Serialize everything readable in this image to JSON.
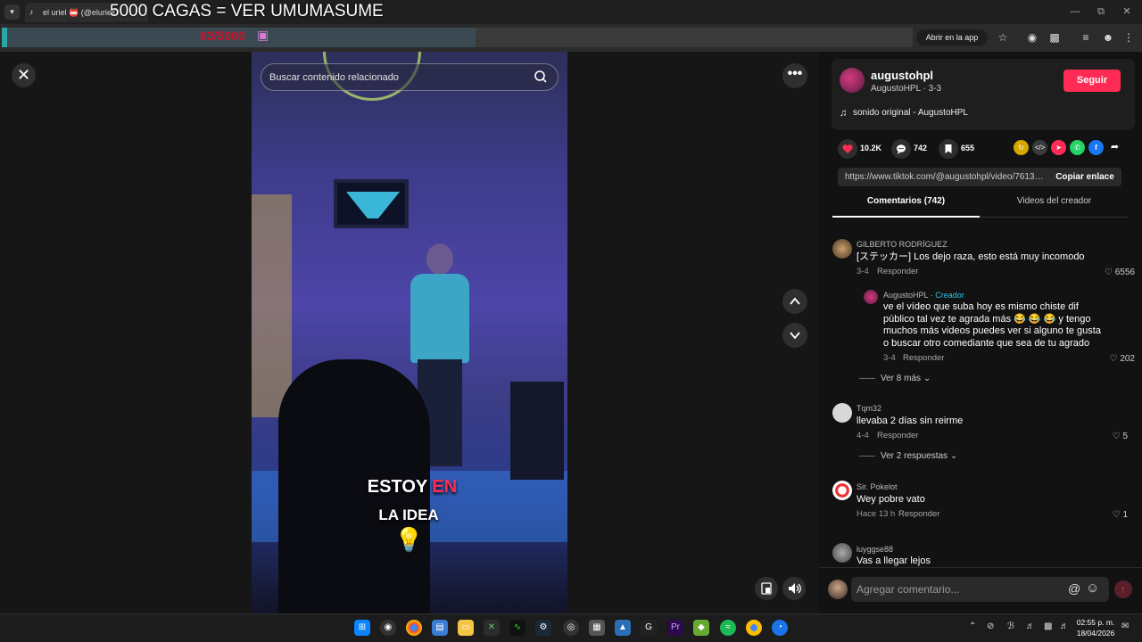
{
  "browser": {
    "tab_title": "el uriel 📛 (@eluriel0",
    "overlay_title": "5000 CAGAS = VER UMUMASUME",
    "progress_text": "63/5000",
    "open_app_label": "Abrir en la app",
    "window_min": "—",
    "window_restore": "⧉",
    "window_close": "✕"
  },
  "video": {
    "search_placeholder": "Buscar contenido relacionado",
    "caption_line1_a": "ESTOY ",
    "caption_line1_b": "EN",
    "caption_line2": "LA IDEA",
    "bulb": "💡",
    "close_glyph": "✕",
    "more_glyph": "•••"
  },
  "author": {
    "username": "augustohpl",
    "display": "AugustoHPL · 3-3",
    "follow_label": "Seguir",
    "music_glyph": "♫",
    "music": "sonido original - AugustoHPL"
  },
  "stats": {
    "likes": "10.2K",
    "comments": "742",
    "saves": "655"
  },
  "link": {
    "url": "https://www.tiktok.com/@augustohpl/video/76131...",
    "copy_label": "Copiar enlace"
  },
  "tabs": {
    "comments": "Comentarios (742)",
    "videos": "Videos del creador"
  },
  "comments": [
    {
      "name": "GILBERTO RODRÍGUEZ",
      "text": "[ステッカー] Los dejo raza, esto está muy incomodo",
      "date": "3-4",
      "reply": "Responder",
      "likes": "6556"
    },
    {
      "name": "AugustoHPL",
      "badge": "Creador",
      "text": "ve el vídeo que suba hoy es mismo chiste dif público tal vez te agrada más 😂 😂 😂 y tengo muchos más videos puedes ver si alguno te gusta o buscar otro comediante que sea de tu agrado",
      "date": "3-4",
      "reply": "Responder",
      "likes": "202"
    },
    {
      "name": "Tqm32",
      "text": "llevaba 2 días sin reirme",
      "date": "4-4",
      "reply": "Responder",
      "likes": "5"
    },
    {
      "name": "Sir. Pokelot",
      "text": "Wey pobre vato",
      "date": "Hace 13 h",
      "reply": "Responder",
      "likes": "1"
    },
    {
      "name": "luyggse88",
      "text": "Vas a llegar lejos"
    }
  ],
  "replies_more": [
    "Ver 8 más",
    "Ver 2 respuestas"
  ],
  "comment_input": {
    "placeholder": "Agregar comentario...",
    "mention": "@",
    "emoji": "☺",
    "send": "↑"
  },
  "taskbar": {
    "time": "02:55 p. m.",
    "date": "18/04/2026"
  },
  "colors": {
    "accent": "#fe2c55",
    "creator": "#25c7e9"
  }
}
